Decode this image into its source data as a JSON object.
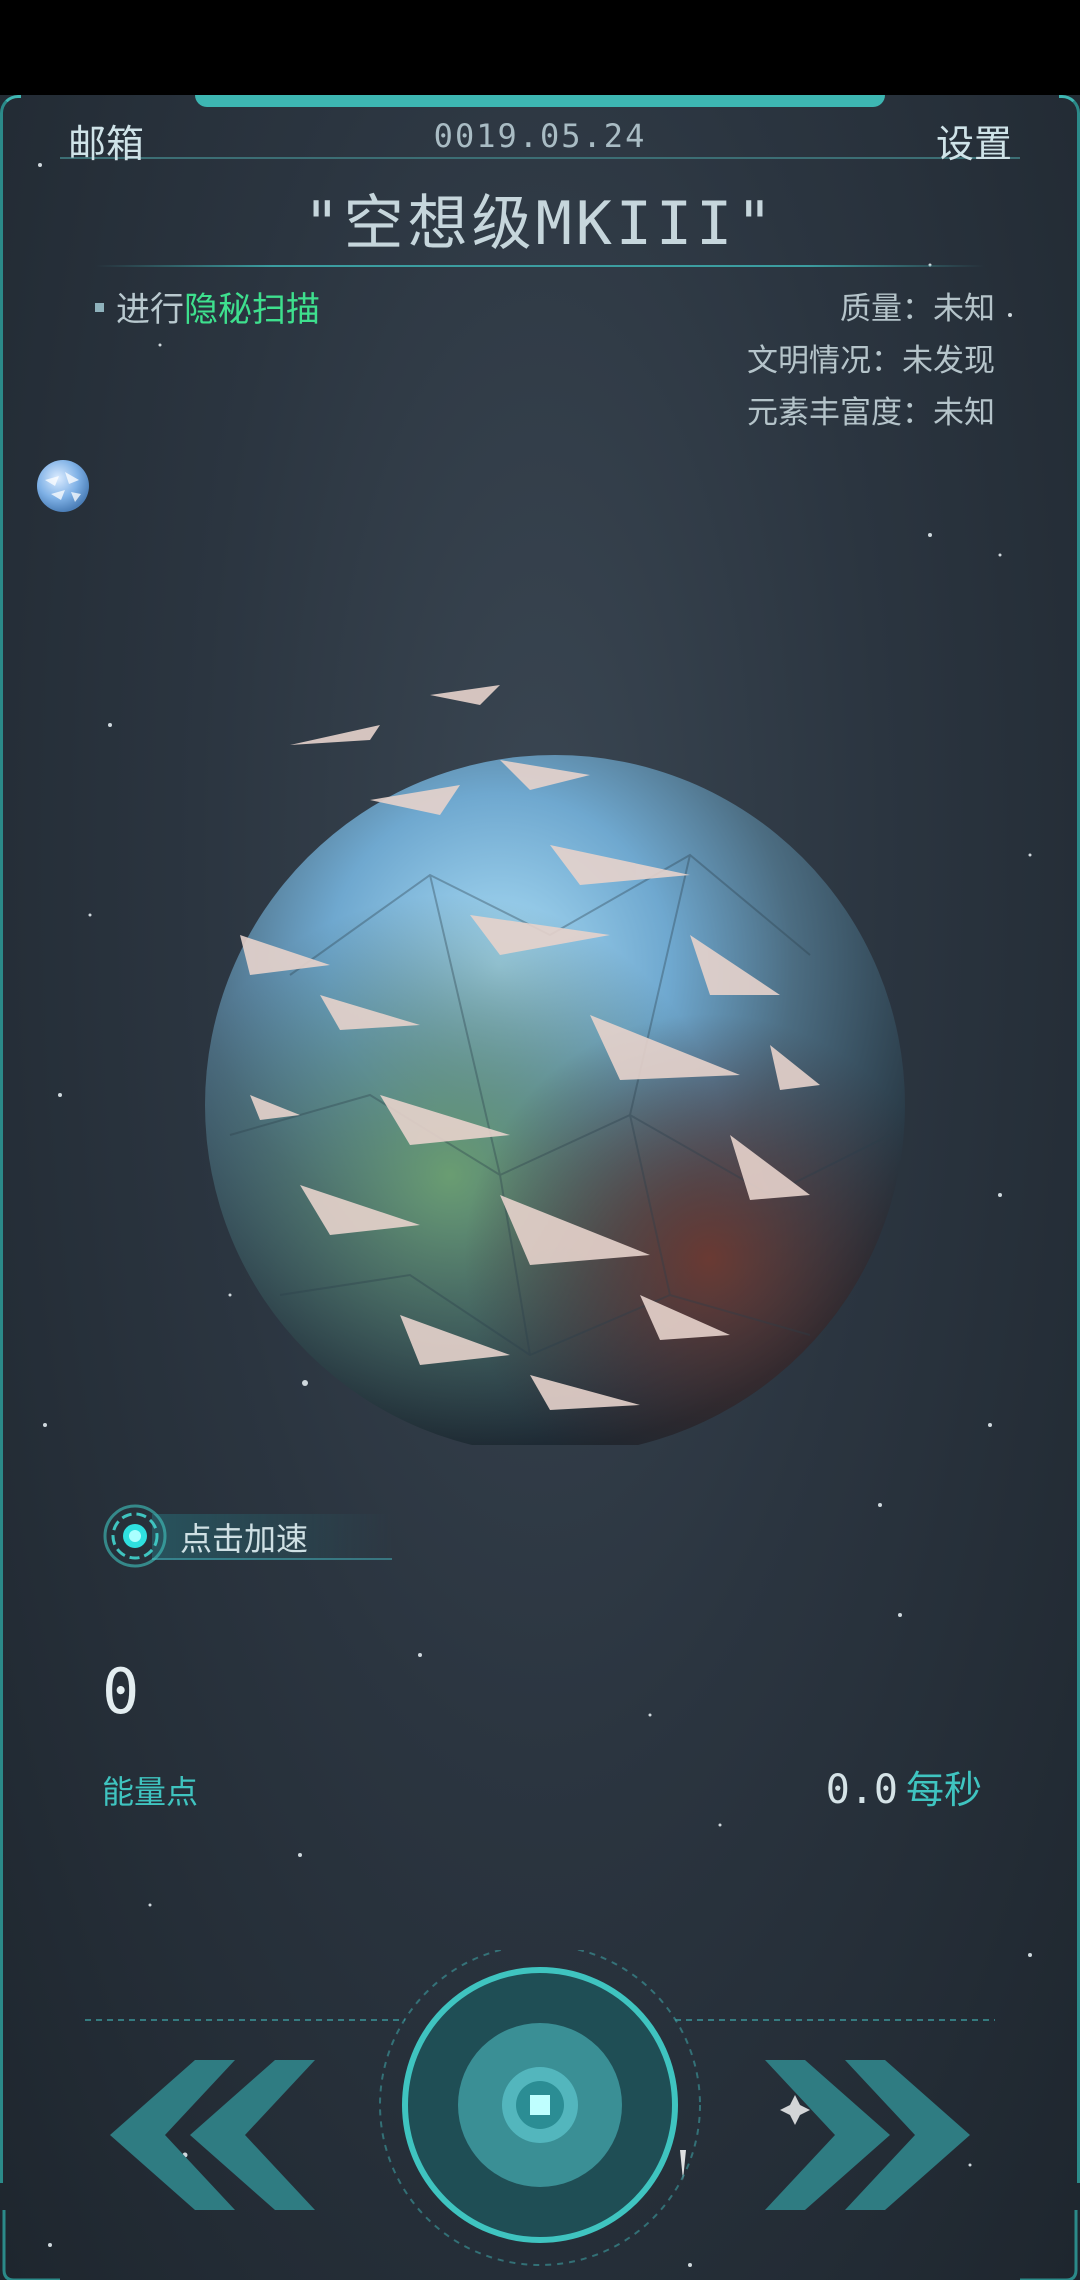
{
  "header": {
    "mailbox_label": "邮箱",
    "date": "0019.05.24",
    "settings_label": "设置"
  },
  "planet": {
    "name": "\"空想级MKIII\""
  },
  "scan": {
    "prefix": "进行",
    "highlight": "隐秘扫描"
  },
  "info": {
    "mass": "质量：未知",
    "civilization": "文明情况：未发现",
    "elements": "元素丰富度：未知"
  },
  "accelerate": {
    "label": "点击加速"
  },
  "energy": {
    "value": "0",
    "label": "能量点",
    "rate_value": "0.0",
    "rate_unit": "每秒"
  },
  "colors": {
    "accent": "#3fc4c0",
    "highlight": "#3ee08e",
    "background": "#2b3540"
  },
  "icons": {
    "left": "double-chevron-left-icon",
    "right": "double-chevron-right-icon",
    "center": "core-button-icon",
    "accelerate": "target-ring-icon"
  }
}
